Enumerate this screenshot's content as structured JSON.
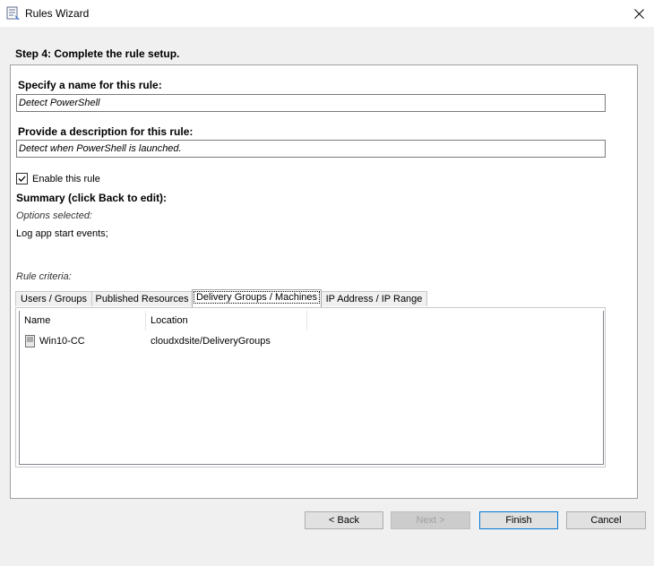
{
  "window": {
    "title": "Rules Wizard",
    "icon": "rules-wizard-icon",
    "close_icon": "close-icon"
  },
  "step_title": "Step 4: Complete the rule setup.",
  "name_section": {
    "label": "Specify a name for this rule:",
    "value": "Detect PowerShell"
  },
  "description_section": {
    "label": "Provide a description for this rule:",
    "value": "Detect when PowerShell is launched."
  },
  "enable_rule": {
    "label": "Enable this rule",
    "checked": true
  },
  "summary": {
    "title": "Summary (click Back to edit):",
    "options_label": "Options selected:",
    "options_value": "Log app start events;",
    "criteria_label": "Rule criteria:"
  },
  "tabs": [
    {
      "label": "Users / Groups",
      "active": false
    },
    {
      "label": "Published Resources",
      "active": false
    },
    {
      "label": "Delivery Groups / Machines",
      "active": true
    },
    {
      "label": "IP Address / IP Range",
      "active": false
    }
  ],
  "table": {
    "columns": [
      "Name",
      "Location"
    ],
    "rows": [
      {
        "name": "Win10-CC",
        "location": "cloudxdsite/DeliveryGroups",
        "icon": "machine-icon"
      }
    ]
  },
  "buttons": {
    "back": "< Back",
    "next": "Next >",
    "finish": "Finish",
    "cancel": "Cancel"
  }
}
